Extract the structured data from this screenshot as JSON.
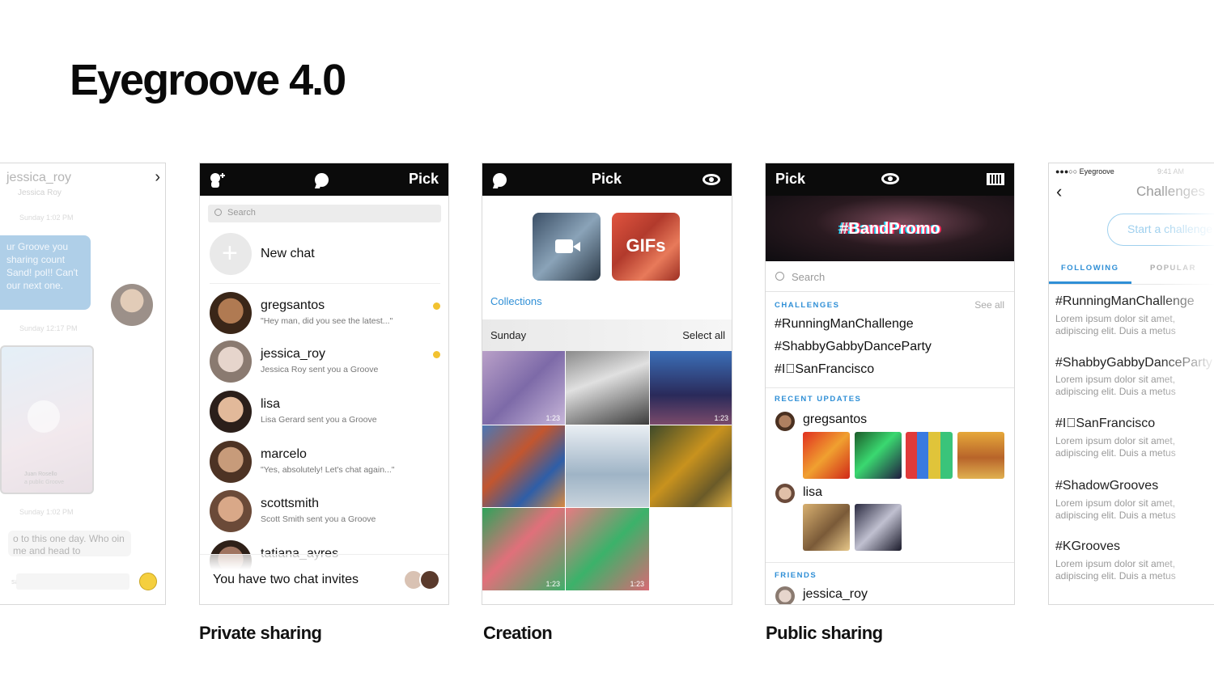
{
  "page": {
    "title": "Eyegroove 4.0"
  },
  "captions": {
    "private": "Private sharing",
    "creation": "Creation",
    "public": "Public sharing"
  },
  "left_chat": {
    "title": "jessica_roy",
    "subtitle": "Jessica Roy",
    "timestamp_1": "Sunday 1:02 PM",
    "bubble_text": "ur Groove you sharing count Sand! pol!! Can't our next one.",
    "timestamp_2": "Sunday 12:17 PM",
    "video_caption": "Juan Rosello",
    "video_subcaption": "a public Groove",
    "timestamp_3": "Sunday 1:02 PM",
    "received_text": "o to this one day. Who oin me and head to",
    "input_placeholder": "sage"
  },
  "private_sharing": {
    "header_title": "Pick",
    "search_placeholder": "Search",
    "new_chat_label": "New chat",
    "chats": [
      {
        "name": "gregsantos",
        "message": "\"Hey man, did you see the latest...\"",
        "unread": true
      },
      {
        "name": "jessica_roy",
        "message": "Jessica Roy sent you a Groove",
        "unread": true
      },
      {
        "name": "lisa",
        "message": "Lisa Gerard sent you a Groove",
        "unread": false
      },
      {
        "name": "marcelo",
        "message": "\"Yes, absolutely! Let's chat again...\"",
        "unread": false
      },
      {
        "name": "scottsmith",
        "message": "Scott Smith sent you a Groove",
        "unread": false
      },
      {
        "name": "tatiana_ayres",
        "message": "",
        "unread": false
      }
    ],
    "invites_label": "You have two chat invites"
  },
  "creation": {
    "header_title": "Pick",
    "tile_video_icon": "video-camera-icon",
    "tile_gifs_label": "GIFs",
    "collections_label": "Collections",
    "section_day": "Sunday",
    "select_all_label": "Select all",
    "durations": [
      "1:23",
      "1:23",
      "1:23",
      "1:23"
    ]
  },
  "public_sharing": {
    "header_title": "Pick",
    "hero_tag": "#BandPromo",
    "search_placeholder": "Search",
    "challenges_heading": "CHALLENGES",
    "see_all_label": "See all",
    "challenges": [
      "#RunningManChallenge",
      "#ShabbyGabbyDanceParty",
      "#ISanFrancisco"
    ],
    "recent_updates_heading": "RECENT UPDATES",
    "recent_users": [
      "gregsantos",
      "lisa"
    ],
    "friends_heading": "FRIENDS",
    "friends": [
      "jessica_roy"
    ]
  },
  "right_challenges": {
    "status_carrier": "●●●○○ Eyegroove",
    "status_time": "9:41 AM",
    "title": "Challenges",
    "start_button": "Start a challenge",
    "tab_following": "FOLLOWING",
    "tab_popular": "POPULAR",
    "items": [
      {
        "tag": "#RunningManChallenge",
        "line1": "Lorem ipsum dolor sit amet,",
        "line2": "adipiscing elit. Duis a metus"
      },
      {
        "tag": "#ShabbyGabbyDanceParty",
        "line1": "Lorem ipsum dolor sit amet,",
        "line2": "adipiscing elit. Duis a metus"
      },
      {
        "tag": "#ISanFrancisco",
        "line1": "Lorem ipsum dolor sit amet,",
        "line2": "adipiscing elit. Duis a metus"
      },
      {
        "tag": "#ShadowGrooves",
        "line1": "Lorem ipsum dolor sit amet,",
        "line2": "adipiscing elit. Duis a metus"
      },
      {
        "tag": "#KGrooves",
        "line1": "Lorem ipsum dolor sit amet,",
        "line2": "adipiscing elit. Duis a metus"
      }
    ]
  },
  "colors": {
    "accent_blue": "#2f8fd6",
    "unread_dot": "#f2c230",
    "header_black": "#0b0b0b"
  }
}
